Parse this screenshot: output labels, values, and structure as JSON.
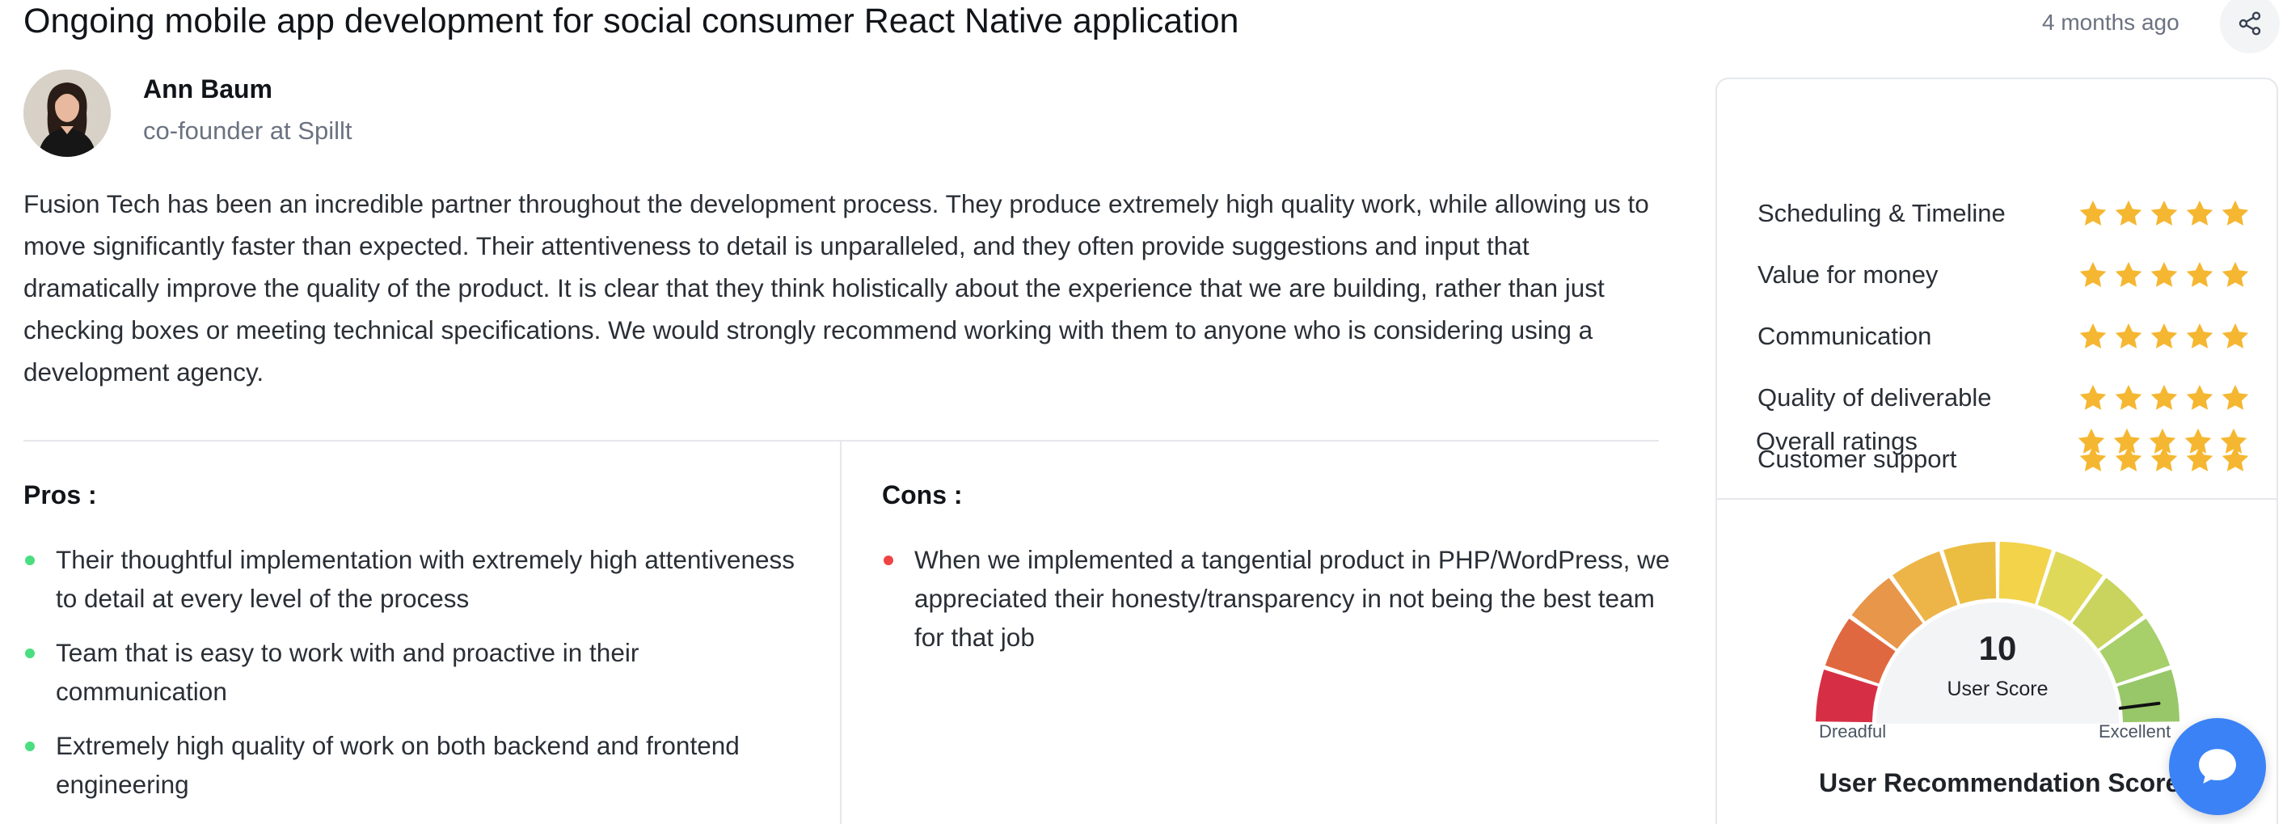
{
  "review": {
    "title": "Ongoing mobile app development for social consumer React Native application",
    "time_ago": "4 months ago",
    "reviewer": {
      "name": "Ann Baum",
      "role": "co-founder at Spillt"
    },
    "body": "Fusion Tech has been an incredible partner throughout the development process. They produce extremely high quality work, while allowing us to move significantly faster than expected. Their attentiveness to detail is unparalleled, and they often provide suggestions and input that dramatically improve the quality of the product. It is clear that they think holistically about the experience that we are building, rather than just checking boxes or meeting technical specifications. We would strongly recommend working with them to anyone who is considering using a development agency.",
    "pros_title": "Pros :",
    "pros": [
      "Their thoughtful implementation with extremely high attentiveness to detail at every level of the process",
      "Team that is easy to work with and proactive in their communication",
      "Extremely high quality of work on both backend and frontend engineering"
    ],
    "cons_title": "Cons :",
    "cons": [
      "When we implemented a tangential product in PHP/WordPress, we appreciated their honesty/transparency in not being the best team for that job"
    ]
  },
  "ratings": [
    {
      "label": "Scheduling & Timeline",
      "stars": 5
    },
    {
      "label": "Value for money",
      "stars": 5
    },
    {
      "label": "Communication",
      "stars": 5
    },
    {
      "label": "Quality of deliverable",
      "stars": 5
    },
    {
      "label": "Customer support",
      "stars": 5
    },
    {
      "label": "Overall ratings",
      "stars": 5
    }
  ],
  "gauge": {
    "score": "10",
    "score_label": "User Score",
    "min_label": "Dreadful",
    "max_label": "Excellent",
    "value_fraction": 0.96,
    "title": "User Recommendation Score",
    "segment_colors": [
      "#d62f45",
      "#e06840",
      "#e8964a",
      "#edb548",
      "#ebbd40",
      "#f2d34a",
      "#dfd95a",
      "#c8d45e",
      "#a7cf6a",
      "#98c76a"
    ]
  },
  "icons": {
    "share": "share-icon",
    "star": "star-icon",
    "chat": "chat-bubble-icon"
  },
  "colors": {
    "star": "#f5b731",
    "pros_bullet": "#4ade80",
    "cons_bullet": "#ef4444",
    "chat": "#3b82f6"
  }
}
